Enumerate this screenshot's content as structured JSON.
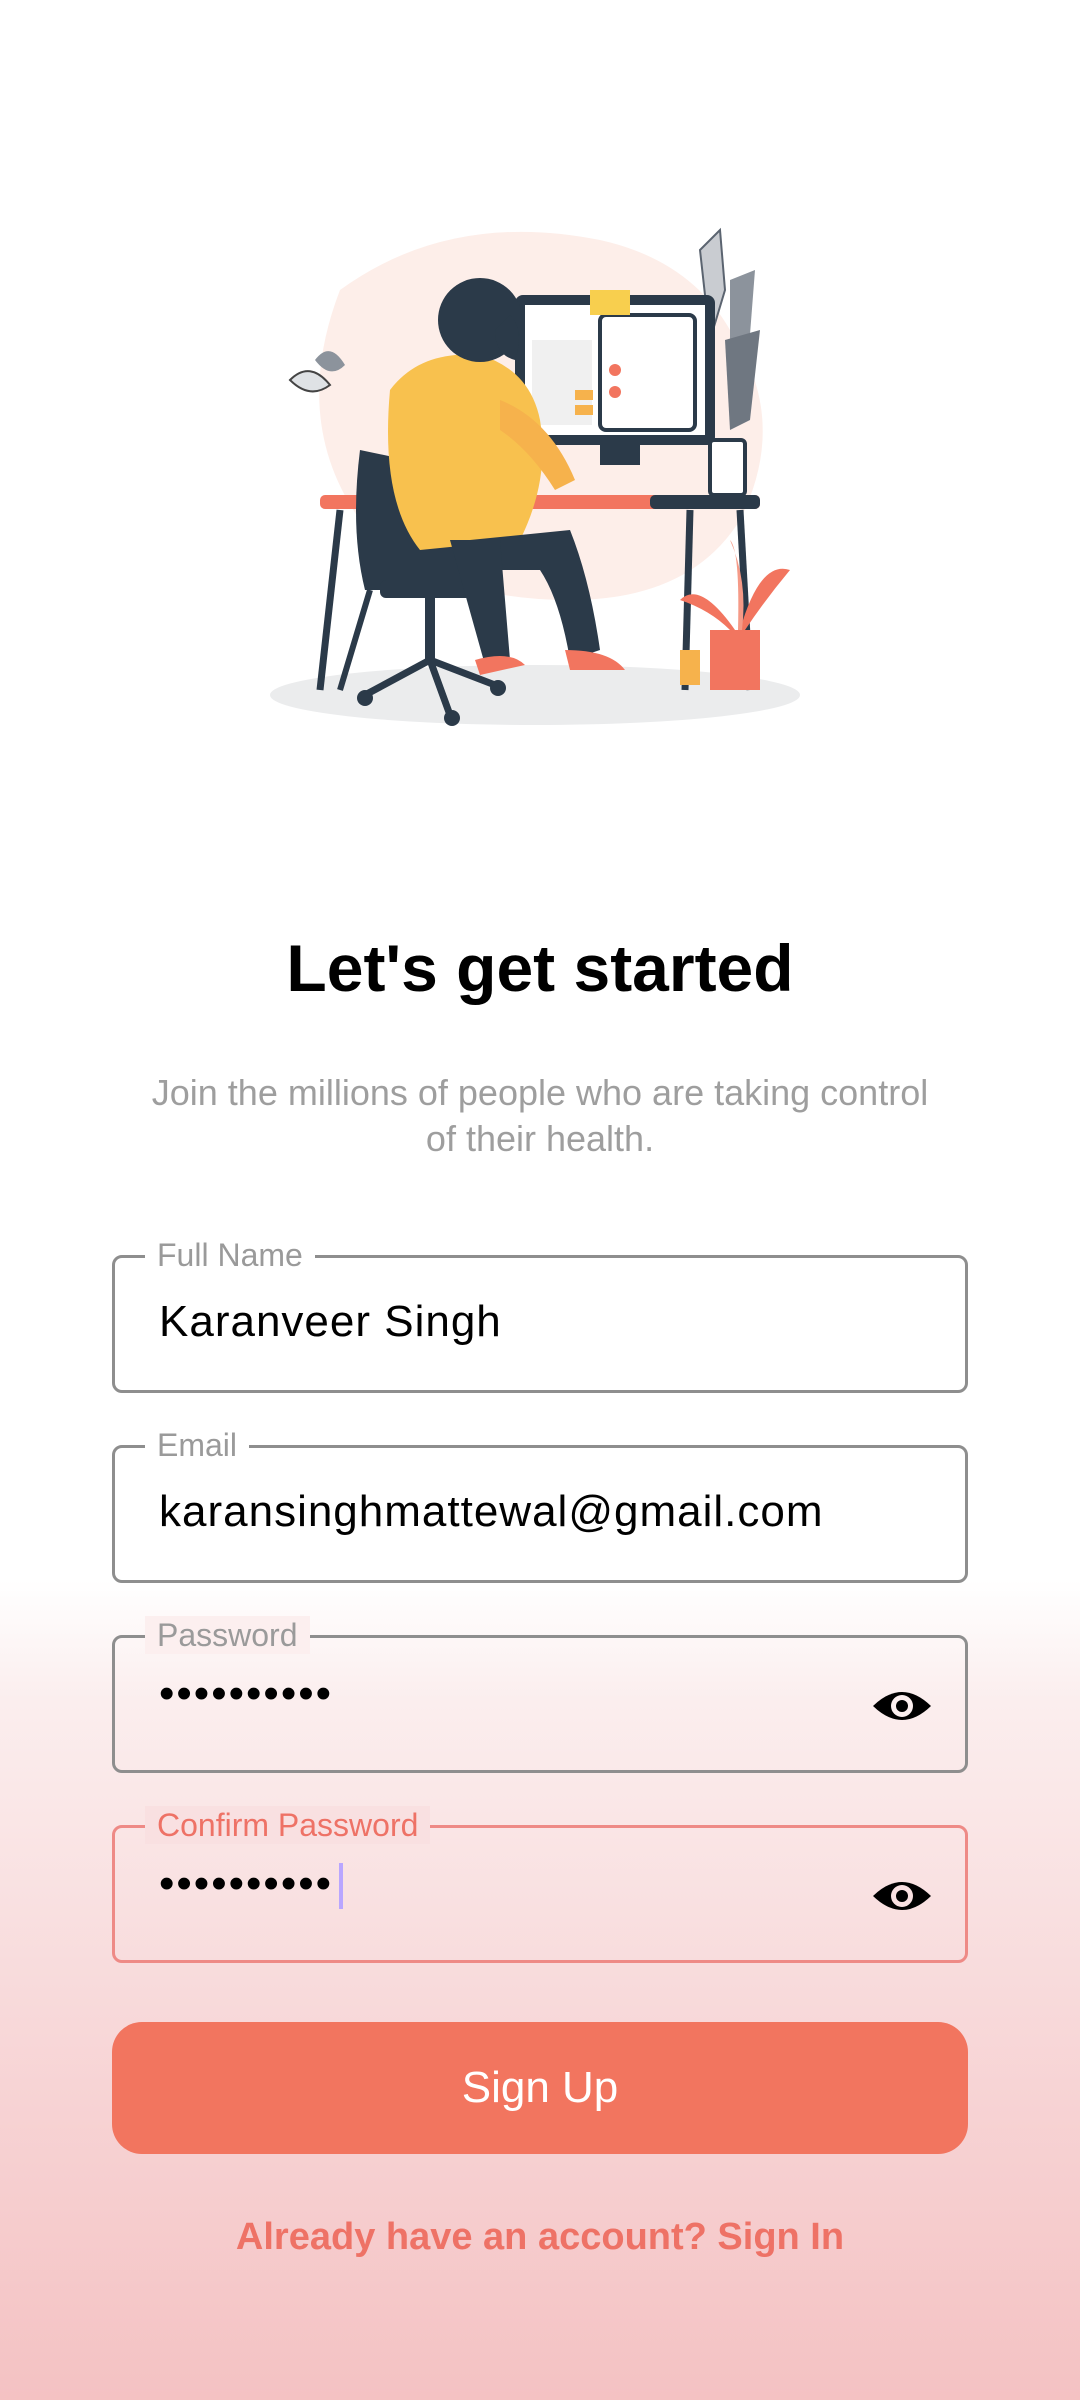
{
  "header": {
    "title": "Let's get started",
    "subtitle": "Join the millions of people who are taking control of their health."
  },
  "form": {
    "full_name": {
      "label": "Full Name",
      "value": "Karanveer Singh"
    },
    "email": {
      "label": "Email",
      "value": "karansinghmattewal@gmail.com"
    },
    "password": {
      "label": "Password",
      "value": "••••••••••"
    },
    "confirm_password": {
      "label": "Confirm Password",
      "value": "••••••••••"
    }
  },
  "actions": {
    "signup_label": "Sign Up",
    "signin_text": "Already have an account? Sign In"
  },
  "colors": {
    "accent": "#f2755f",
    "focus_border": "#ee8a86",
    "muted_text": "#9e9e9e"
  },
  "icons": {
    "password_toggle": "eye-icon",
    "illustration": "person-at-desk-illustration"
  }
}
